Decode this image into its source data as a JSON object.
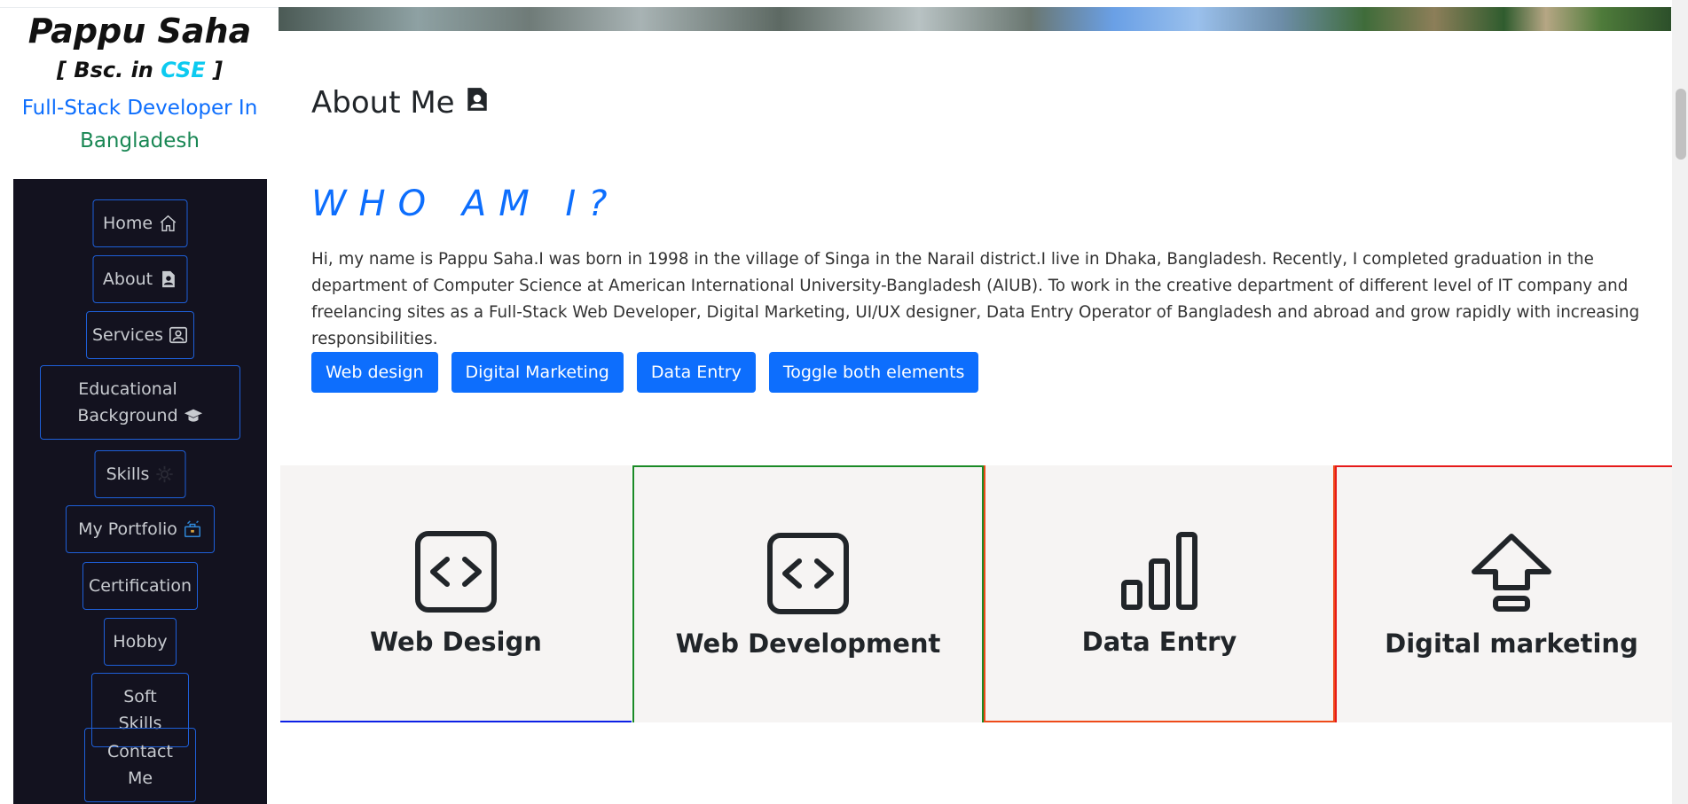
{
  "profile": {
    "name": "Pappu Saha",
    "degree_open": "[ Bsc. in ",
    "degree_accent": "CSE",
    "degree_close": " ]",
    "role_blue": "Full-Stack Developer In",
    "role_green": "Bangladesh"
  },
  "sidebar": {
    "items": [
      {
        "label": "Home",
        "icon": "home-icon"
      },
      {
        "label": "About",
        "icon": "contact-card-icon"
      },
      {
        "label": "Services",
        "icon": "person-badge-icon"
      },
      {
        "label": "Educational Background",
        "icon": "graduation-cap-icon"
      },
      {
        "label": "Skills",
        "icon": "gear-icon"
      },
      {
        "label": "My Portfolio",
        "icon": "portfolio-icon"
      },
      {
        "label": "Certification",
        "icon": ""
      },
      {
        "label": "Hobby",
        "icon": ""
      },
      {
        "label": "Soft Skills",
        "icon": ""
      },
      {
        "label": "Contact Me",
        "icon": ""
      }
    ]
  },
  "main": {
    "about_title": "About Me",
    "who_heading": "WHO AM I?",
    "intro": "Hi, my name is Pappu Saha.I was born in 1998 in the village of Singa in the Narail district.I live in Dhaka, Bangladesh. Recently, I completed graduation in the department of Computer Science at American International University-Bangladesh (AIUB). To work in the creative department of different level of IT company and freelancing sites as a Full-Stack Web Developer, Digital Marketing, UI/UX designer, Data Entry Operator of Bangladesh and abroad and grow rapidly with increasing responsibilities.",
    "buttons": [
      "Web design",
      "Digital Marketing",
      "Data Entry",
      "Toggle both elements"
    ],
    "cards": [
      {
        "title": "Web Design",
        "icon": "code-square-icon"
      },
      {
        "title": "Web Development",
        "icon": "code-square-icon"
      },
      {
        "title": "Data Entry",
        "icon": "bar-chart-icon"
      },
      {
        "title": "Digital marketing",
        "icon": "arrow-up-icon"
      }
    ]
  },
  "colors": {
    "primary": "#0d6efd",
    "accent_cyan": "#0dcaf0",
    "green": "#198754",
    "sidebar_bg": "#13121f",
    "card_bg": "#f6f4f3"
  }
}
